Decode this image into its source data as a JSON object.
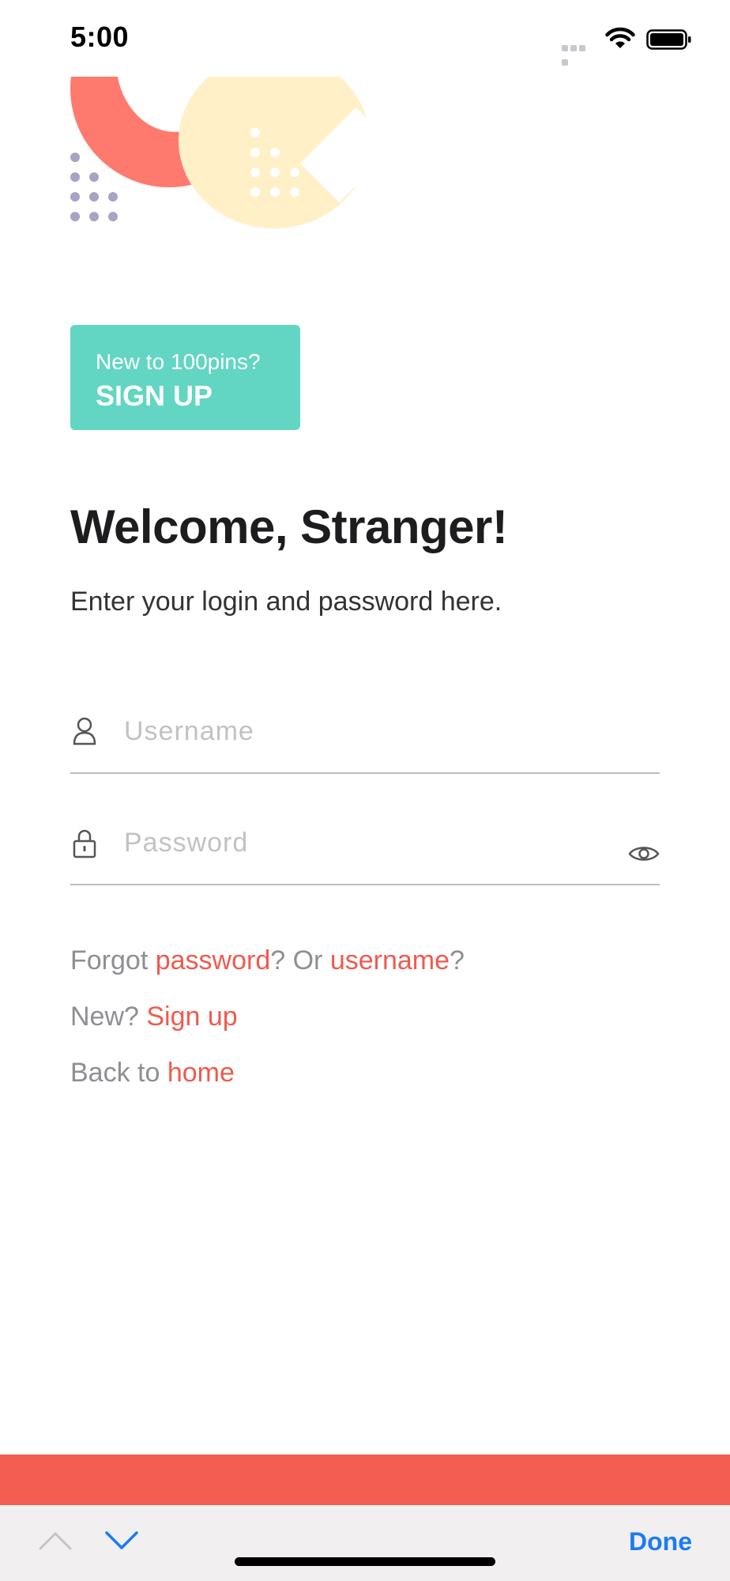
{
  "status_bar": {
    "time": "5:00",
    "icons": [
      "signal-dots-icon",
      "wifi-icon",
      "battery-icon"
    ]
  },
  "signup_card": {
    "prompt": "New to 100pins?",
    "action": "SIGN UP"
  },
  "welcome": {
    "title": "Welcome, Stranger!",
    "subtitle": "Enter your login and password here."
  },
  "form": {
    "username_placeholder": "Username",
    "password_placeholder": "Password",
    "username_value": "",
    "password_value": ""
  },
  "links": {
    "forgot_prefix": "Forgot ",
    "forgot_password": "password",
    "forgot_middle": "? Or ",
    "forgot_username": "username",
    "forgot_suffix": "?",
    "new_prefix": "New? ",
    "new_link": "Sign up",
    "back_prefix": "Back to ",
    "back_link": "home"
  },
  "keyboard_toolbar": {
    "done_label": "Done"
  },
  "colors": {
    "accent_red": "#f05a4e",
    "signup_teal": "#62d6c2",
    "illustration_coral": "#ff7a6e",
    "illustration_cream": "#fff0c8",
    "illustration_dots": "#a8a3c2",
    "done_blue": "#1a7cf5"
  }
}
